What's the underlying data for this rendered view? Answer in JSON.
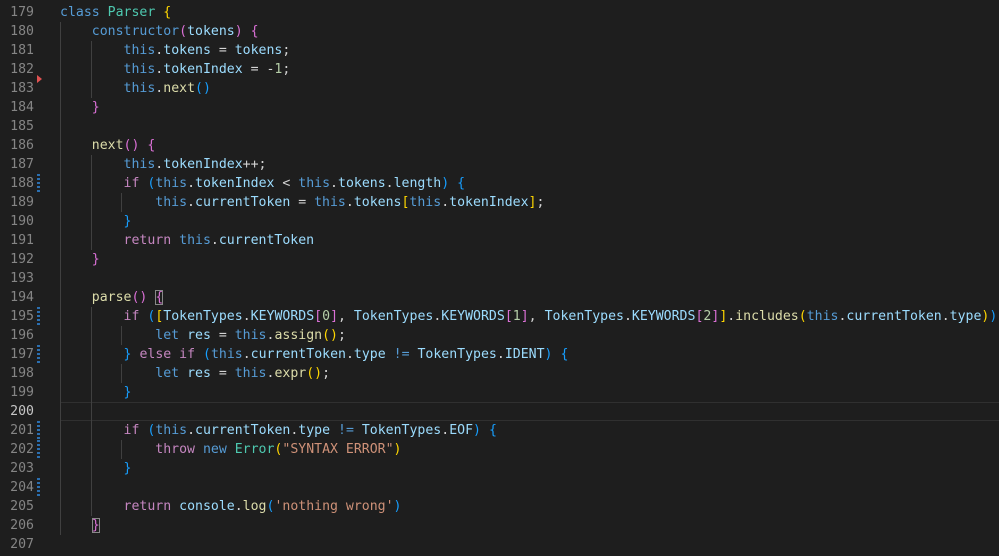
{
  "editor": {
    "line_numbers": [
      "179",
      "180",
      "181",
      "182",
      "183",
      "184",
      "185",
      "186",
      "187",
      "188",
      "189",
      "190",
      "191",
      "192",
      "193",
      "194",
      "195",
      "196",
      "197",
      "198",
      "199",
      "200",
      "201",
      "202",
      "203",
      "204",
      "205",
      "206",
      "207"
    ],
    "active_line_index": 21,
    "modified_line_indices": [
      9,
      16,
      18,
      22,
      23,
      25
    ],
    "deleted_marker_index": 3,
    "colors": {
      "background": "#1e1e1e",
      "keyword": "#569cd6",
      "class": "#4ec9b0",
      "function": "#dcdcaa",
      "property": "#9cdcfe",
      "control": "#c586c0",
      "number": "#b5cea8",
      "string": "#ce9178",
      "bracket_level_1": "#ffd700",
      "bracket_level_2": "#da70d6",
      "bracket_level_3": "#179fff"
    },
    "lines": [
      [
        [
          "kw",
          "class"
        ],
        [
          "txt",
          " "
        ],
        [
          "cls",
          "Parser"
        ],
        [
          "txt",
          " "
        ],
        [
          "br1",
          "{"
        ]
      ],
      [
        [
          "txt",
          "    "
        ],
        [
          "kw",
          "constructor"
        ],
        [
          "br2",
          "("
        ],
        [
          "prop",
          "tokens"
        ],
        [
          "br2",
          ")"
        ],
        [
          "txt",
          " "
        ],
        [
          "br2",
          "{"
        ]
      ],
      [
        [
          "txt",
          "        "
        ],
        [
          "kw",
          "this"
        ],
        [
          "txt",
          "."
        ],
        [
          "prop",
          "tokens"
        ],
        [
          "txt",
          " = "
        ],
        [
          "prop",
          "tokens"
        ],
        [
          "txt",
          ";"
        ]
      ],
      [
        [
          "txt",
          "        "
        ],
        [
          "kw",
          "this"
        ],
        [
          "txt",
          "."
        ],
        [
          "prop",
          "tokenIndex"
        ],
        [
          "txt",
          " = -"
        ],
        [
          "num",
          "1"
        ],
        [
          "txt",
          ";"
        ]
      ],
      [
        [
          "txt",
          "        "
        ],
        [
          "kw",
          "this"
        ],
        [
          "txt",
          "."
        ],
        [
          "fn",
          "next"
        ],
        [
          "br3",
          "()"
        ]
      ],
      [
        [
          "txt",
          "    "
        ],
        [
          "br2",
          "}"
        ]
      ],
      [],
      [
        [
          "txt",
          "    "
        ],
        [
          "fn",
          "next"
        ],
        [
          "br2",
          "()"
        ],
        [
          "txt",
          " "
        ],
        [
          "br2",
          "{"
        ]
      ],
      [
        [
          "txt",
          "        "
        ],
        [
          "kw",
          "this"
        ],
        [
          "txt",
          "."
        ],
        [
          "prop",
          "tokenIndex"
        ],
        [
          "txt",
          "++;"
        ]
      ],
      [
        [
          "txt",
          "        "
        ],
        [
          "ctl",
          "if"
        ],
        [
          "txt",
          " "
        ],
        [
          "br3",
          "("
        ],
        [
          "kw",
          "this"
        ],
        [
          "txt",
          "."
        ],
        [
          "prop",
          "tokenIndex"
        ],
        [
          "txt",
          " < "
        ],
        [
          "kw",
          "this"
        ],
        [
          "txt",
          "."
        ],
        [
          "prop",
          "tokens"
        ],
        [
          "txt",
          "."
        ],
        [
          "prop",
          "length"
        ],
        [
          "br3",
          ")"
        ],
        [
          "txt",
          " "
        ],
        [
          "br3",
          "{"
        ]
      ],
      [
        [
          "txt",
          "            "
        ],
        [
          "kw",
          "this"
        ],
        [
          "txt",
          "."
        ],
        [
          "prop",
          "currentToken"
        ],
        [
          "txt",
          " = "
        ],
        [
          "kw",
          "this"
        ],
        [
          "txt",
          "."
        ],
        [
          "prop",
          "tokens"
        ],
        [
          "br1",
          "["
        ],
        [
          "kw",
          "this"
        ],
        [
          "txt",
          "."
        ],
        [
          "prop",
          "tokenIndex"
        ],
        [
          "br1",
          "]"
        ],
        [
          "txt",
          ";"
        ]
      ],
      [
        [
          "txt",
          "        "
        ],
        [
          "br3",
          "}"
        ]
      ],
      [
        [
          "txt",
          "        "
        ],
        [
          "ctl",
          "return"
        ],
        [
          "txt",
          " "
        ],
        [
          "kw",
          "this"
        ],
        [
          "txt",
          "."
        ],
        [
          "prop",
          "currentToken"
        ]
      ],
      [
        [
          "txt",
          "    "
        ],
        [
          "br2",
          "}"
        ]
      ],
      [],
      [
        [
          "txt",
          "    "
        ],
        [
          "fn",
          "parse"
        ],
        [
          "br2",
          "()"
        ],
        [
          "txt",
          " "
        ],
        [
          "br2",
          "{"
        ]
      ],
      [
        [
          "txt",
          "        "
        ],
        [
          "ctl",
          "if"
        ],
        [
          "txt",
          " "
        ],
        [
          "br3",
          "("
        ],
        [
          "br1",
          "["
        ],
        [
          "prop",
          "TokenTypes"
        ],
        [
          "txt",
          "."
        ],
        [
          "prop",
          "KEYWORDS"
        ],
        [
          "br2",
          "["
        ],
        [
          "num",
          "0"
        ],
        [
          "br2",
          "]"
        ],
        [
          "txt",
          ", "
        ],
        [
          "prop",
          "TokenTypes"
        ],
        [
          "txt",
          "."
        ],
        [
          "prop",
          "KEYWORDS"
        ],
        [
          "br2",
          "["
        ],
        [
          "num",
          "1"
        ],
        [
          "br2",
          "]"
        ],
        [
          "txt",
          ", "
        ],
        [
          "prop",
          "TokenTypes"
        ],
        [
          "txt",
          "."
        ],
        [
          "prop",
          "KEYWORDS"
        ],
        [
          "br2",
          "["
        ],
        [
          "num",
          "2"
        ],
        [
          "br2",
          "]"
        ],
        [
          "br1",
          "]"
        ],
        [
          "txt",
          "."
        ],
        [
          "fn",
          "includes"
        ],
        [
          "br1",
          "("
        ],
        [
          "kw",
          "this"
        ],
        [
          "txt",
          "."
        ],
        [
          "prop",
          "currentToken"
        ],
        [
          "txt",
          "."
        ],
        [
          "prop",
          "type"
        ],
        [
          "br1",
          ")"
        ],
        [
          "br3",
          ")"
        ],
        [
          "txt",
          " "
        ],
        [
          "br3",
          "{"
        ]
      ],
      [
        [
          "txt",
          "            "
        ],
        [
          "kw",
          "let"
        ],
        [
          "txt",
          " "
        ],
        [
          "prop",
          "res"
        ],
        [
          "txt",
          " = "
        ],
        [
          "kw",
          "this"
        ],
        [
          "txt",
          "."
        ],
        [
          "fn",
          "assign"
        ],
        [
          "br1",
          "()"
        ],
        [
          "txt",
          ";"
        ]
      ],
      [
        [
          "txt",
          "        "
        ],
        [
          "br3",
          "}"
        ],
        [
          "txt",
          " "
        ],
        [
          "ctl",
          "else"
        ],
        [
          "txt",
          " "
        ],
        [
          "ctl",
          "if"
        ],
        [
          "txt",
          " "
        ],
        [
          "br3",
          "("
        ],
        [
          "kw",
          "this"
        ],
        [
          "txt",
          "."
        ],
        [
          "prop",
          "currentToken"
        ],
        [
          "txt",
          "."
        ],
        [
          "prop",
          "type"
        ],
        [
          "txt",
          " "
        ],
        [
          "kw",
          "!="
        ],
        [
          "txt",
          " "
        ],
        [
          "prop",
          "TokenTypes"
        ],
        [
          "txt",
          "."
        ],
        [
          "prop",
          "IDENT"
        ],
        [
          "br3",
          ")"
        ],
        [
          "txt",
          " "
        ],
        [
          "br3",
          "{"
        ]
      ],
      [
        [
          "txt",
          "            "
        ],
        [
          "kw",
          "let"
        ],
        [
          "txt",
          " "
        ],
        [
          "prop",
          "res"
        ],
        [
          "txt",
          " = "
        ],
        [
          "kw",
          "this"
        ],
        [
          "txt",
          "."
        ],
        [
          "fn",
          "expr"
        ],
        [
          "br1",
          "()"
        ],
        [
          "txt",
          ";"
        ]
      ],
      [
        [
          "txt",
          "        "
        ],
        [
          "br3",
          "}"
        ]
      ],
      [],
      [
        [
          "txt",
          "        "
        ],
        [
          "ctl",
          "if"
        ],
        [
          "txt",
          " "
        ],
        [
          "br3",
          "("
        ],
        [
          "kw",
          "this"
        ],
        [
          "txt",
          "."
        ],
        [
          "prop",
          "currentToken"
        ],
        [
          "txt",
          "."
        ],
        [
          "prop",
          "type"
        ],
        [
          "txt",
          " "
        ],
        [
          "kw",
          "!="
        ],
        [
          "txt",
          " "
        ],
        [
          "prop",
          "TokenTypes"
        ],
        [
          "txt",
          "."
        ],
        [
          "prop",
          "EOF"
        ],
        [
          "br3",
          ")"
        ],
        [
          "txt",
          " "
        ],
        [
          "br3",
          "{"
        ]
      ],
      [
        [
          "txt",
          "            "
        ],
        [
          "ctl",
          "throw"
        ],
        [
          "txt",
          " "
        ],
        [
          "kw",
          "new"
        ],
        [
          "txt",
          " "
        ],
        [
          "cls",
          "Error"
        ],
        [
          "br1",
          "("
        ],
        [
          "str",
          "\"SYNTAX ERROR\""
        ],
        [
          "br1",
          ")"
        ]
      ],
      [
        [
          "txt",
          "        "
        ],
        [
          "br3",
          "}"
        ]
      ],
      [],
      [
        [
          "txt",
          "        "
        ],
        [
          "ctl",
          "return"
        ],
        [
          "txt",
          " "
        ],
        [
          "prop",
          "console"
        ],
        [
          "txt",
          "."
        ],
        [
          "fn",
          "log"
        ],
        [
          "br3",
          "("
        ],
        [
          "str",
          "'nothing wrong'"
        ],
        [
          "br3",
          ")"
        ]
      ],
      [
        [
          "txt",
          "    "
        ],
        [
          "br2",
          "}"
        ]
      ],
      []
    ]
  }
}
